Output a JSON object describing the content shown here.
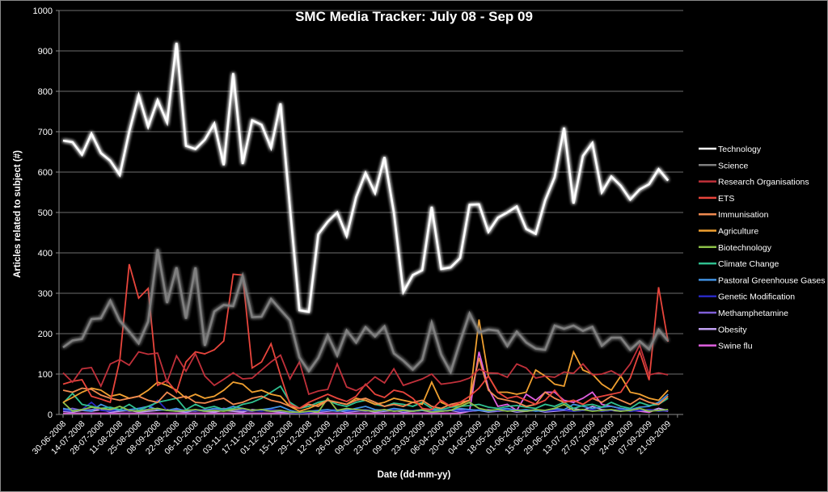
{
  "chart_data": {
    "type": "line",
    "title": "SMC Media Tracker: July 08 - Sep 09",
    "xlabel": "Date (dd-mm-yy)",
    "ylabel": "Articles related to subject (#)",
    "ylim": [
      0,
      1000
    ],
    "yticks": [
      0,
      100,
      200,
      300,
      400,
      500,
      600,
      700,
      800,
      900,
      1000
    ],
    "grid": true,
    "legend": "right",
    "x_tick_labels": [
      "30-06-2008",
      "14-07-2008",
      "28-07-2008",
      "11-08-2008",
      "25-08-2008",
      "08-09-2008",
      "22-09-2008",
      "06-10-2008",
      "20-10-2008",
      "03-11-2008",
      "17-11-2008",
      "01-12-2008",
      "15-12-2008",
      "29-12-2008",
      "12-01-2009",
      "26-01-2009",
      "09-02-2009",
      "23-02-2009",
      "09-03-2009",
      "23-03-2009",
      "06-04-2009",
      "20-04-2009",
      "04-05-2009",
      "18-05-2009",
      "01-06-2009",
      "15-06-2009",
      "29-06-2009",
      "13-07-2009",
      "27-07-2009",
      "10-08-2009",
      "24-08-2009",
      "07-09-2009",
      "21-09-2009"
    ],
    "series": [
      {
        "name": "Technology",
        "color": "#ffffff",
        "glow": true,
        "values": [
          678,
          674,
          643,
          695,
          647,
          628,
          593,
          700,
          790,
          712,
          778,
          723,
          920,
          665,
          657,
          680,
          720,
          617,
          845,
          620,
          728,
          717,
          660,
          770,
          512,
          258,
          254,
          446,
          477,
          500,
          442,
          538,
          598,
          548,
          637,
          500,
          303,
          345,
          357,
          514,
          360,
          364,
          387,
          519,
          520,
          452,
          487,
          500,
          515,
          459,
          447,
          530,
          587,
          710,
          522,
          640,
          672,
          550,
          589,
          566,
          532,
          557,
          570,
          607,
          579,
          null
        ]
      },
      {
        "name": "Science",
        "color": "#7f7f7f",
        "glow": true,
        "values": [
          166,
          183,
          187,
          236,
          238,
          282,
          232,
          205,
          176,
          230,
          409,
          276,
          364,
          237,
          364,
          170,
          255,
          271,
          268,
          343,
          241,
          242,
          286,
          259,
          233,
          141,
          107,
          140,
          196,
          146,
          208,
          178,
          216,
          193,
          218,
          151,
          133,
          111,
          135,
          227,
          148,
          105,
          180,
          250,
          203,
          210,
          207,
          169,
          205,
          178,
          163,
          160,
          220,
          212,
          220,
          207,
          217,
          170,
          190,
          190,
          160,
          181,
          161,
          210,
          182,
          null
        ]
      },
      {
        "name": "Research Organisations",
        "color": "#c0303a",
        "values": [
          103,
          80,
          113,
          116,
          70,
          125,
          136,
          122,
          155,
          149,
          152,
          80,
          145,
          107,
          150,
          95,
          72,
          87,
          103,
          88,
          90,
          110,
          130,
          147,
          88,
          130,
          50,
          58,
          62,
          125,
          68,
          59,
          72,
          93,
          78,
          113,
          72,
          80,
          88,
          100,
          75,
          78,
          82,
          90,
          112,
          103,
          102,
          92,
          125,
          115,
          90,
          95,
          92,
          105,
          102,
          125,
          98,
          100,
          108,
          95,
          125,
          172,
          98,
          103,
          98,
          null
        ]
      },
      {
        "name": "ETS",
        "color": "#e8453c",
        "values": [
          75,
          82,
          86,
          45,
          38,
          30,
          134,
          372,
          288,
          312,
          72,
          84,
          55,
          130,
          155,
          150,
          160,
          182,
          347,
          345,
          115,
          130,
          175,
          97,
          25,
          15,
          30,
          40,
          50,
          40,
          32,
          45,
          75,
          50,
          42,
          60,
          55,
          40,
          15,
          12,
          35,
          20,
          30,
          45,
          65,
          95,
          55,
          40,
          45,
          35,
          25,
          35,
          60,
          30,
          35,
          25,
          40,
          45,
          50,
          55,
          90,
          155,
          85,
          315,
          180,
          null
        ]
      },
      {
        "name": "Immunisation",
        "color": "#f08a50",
        "values": [
          60,
          55,
          65,
          62,
          48,
          40,
          35,
          40,
          45,
          35,
          30,
          55,
          40,
          45,
          30,
          28,
          35,
          40,
          25,
          30,
          40,
          45,
          35,
          30,
          20,
          15,
          25,
          20,
          35,
          30,
          25,
          35,
          40,
          30,
          20,
          25,
          20,
          30,
          35,
          20,
          15,
          25,
          30,
          35,
          140,
          60,
          40,
          35,
          30,
          20,
          25,
          55,
          40,
          30,
          35,
          25,
          40,
          30,
          45,
          35,
          25,
          40,
          30,
          25,
          45,
          null
        ]
      },
      {
        "name": "Agriculture",
        "color": "#f0a030",
        "values": [
          30,
          42,
          55,
          65,
          60,
          45,
          50,
          40,
          45,
          60,
          80,
          72,
          60,
          40,
          50,
          40,
          45,
          60,
          80,
          75,
          55,
          60,
          50,
          45,
          20,
          8,
          15,
          25,
          35,
          30,
          25,
          40,
          35,
          25,
          30,
          40,
          35,
          30,
          25,
          80,
          30,
          20,
          25,
          35,
          235,
          95,
          55,
          55,
          50,
          55,
          110,
          95,
          75,
          70,
          155,
          110,
          100,
          75,
          60,
          95,
          55,
          50,
          40,
          35,
          60,
          null
        ]
      },
      {
        "name": "Biotechnology",
        "color": "#8cc048",
        "values": [
          30,
          8,
          12,
          18,
          15,
          12,
          20,
          10,
          8,
          12,
          15,
          10,
          8,
          10,
          12,
          8,
          10,
          8,
          12,
          15,
          10,
          12,
          8,
          10,
          6,
          5,
          8,
          6,
          40,
          10,
          15,
          12,
          10,
          8,
          12,
          8,
          10,
          8,
          12,
          6,
          8,
          10,
          20,
          30,
          15,
          10,
          12,
          8,
          10,
          8,
          12,
          10,
          15,
          25,
          10,
          12,
          8,
          10,
          12,
          8,
          10,
          15,
          8,
          10,
          12,
          null
        ]
      },
      {
        "name": "Climate Change",
        "color": "#30c090",
        "values": [
          28,
          52,
          25,
          20,
          15,
          18,
          12,
          25,
          10,
          20,
          30,
          35,
          40,
          12,
          25,
          15,
          20,
          12,
          15,
          25,
          30,
          40,
          55,
          70,
          30,
          15,
          20,
          30,
          35,
          25,
          20,
          30,
          35,
          25,
          20,
          28,
          25,
          20,
          30,
          15,
          12,
          18,
          20,
          22,
          25,
          18,
          15,
          20,
          22,
          18,
          15,
          25,
          20,
          30,
          15,
          22,
          25,
          18,
          30,
          20,
          15,
          30,
          22,
          25,
          40,
          null
        ]
      },
      {
        "name": "Pastoral Greenhouse Gases",
        "color": "#4090e0",
        "values": [
          15,
          10,
          12,
          8,
          25,
          15,
          10,
          12,
          15,
          20,
          12,
          10,
          15,
          8,
          12,
          10,
          15,
          12,
          20,
          15,
          10,
          12,
          15,
          20,
          10,
          5,
          8,
          10,
          12,
          8,
          10,
          15,
          20,
          12,
          10,
          15,
          12,
          8,
          10,
          12,
          8,
          10,
          15,
          12,
          10,
          8,
          12,
          15,
          10,
          12,
          8,
          10,
          15,
          12,
          25,
          20,
          15,
          18,
          20,
          15,
          12,
          18,
          20,
          30,
          50,
          null
        ]
      },
      {
        "name": "Genetic Modification",
        "color": "#2828c0",
        "values": [
          10,
          8,
          12,
          30,
          10,
          8,
          12,
          10,
          15,
          12,
          35,
          10,
          8,
          12,
          10,
          8,
          12,
          10,
          15,
          12,
          10,
          8,
          12,
          10,
          5,
          3,
          5,
          8,
          10,
          12,
          8,
          10,
          12,
          8,
          10,
          12,
          8,
          10,
          12,
          8,
          10,
          12,
          8,
          10,
          12,
          8,
          10,
          12,
          8,
          10,
          12,
          8,
          10,
          12,
          8,
          10,
          12,
          8,
          10,
          12,
          8,
          10,
          12,
          8,
          10,
          null
        ]
      },
      {
        "name": "Methamphetamine",
        "color": "#8060d8",
        "values": [
          12,
          15,
          10,
          12,
          15,
          10,
          12,
          8,
          10,
          12,
          15,
          10,
          12,
          10,
          8,
          12,
          10,
          15,
          12,
          10,
          8,
          12,
          10,
          8,
          5,
          4,
          6,
          8,
          10,
          8,
          12,
          10,
          8,
          10,
          12,
          8,
          10,
          8,
          12,
          10,
          8,
          10,
          12,
          8,
          10,
          12,
          8,
          10,
          12,
          8,
          10,
          8,
          12,
          10,
          8,
          10,
          12,
          8,
          10,
          12,
          8,
          10,
          12,
          10,
          8,
          null
        ]
      },
      {
        "name": "Obesity",
        "color": "#c0a0f0",
        "values": [
          8,
          6,
          10,
          8,
          12,
          6,
          8,
          10,
          6,
          8,
          10,
          12,
          8,
          6,
          10,
          8,
          6,
          10,
          8,
          6,
          12,
          10,
          8,
          6,
          4,
          3,
          5,
          6,
          8,
          10,
          6,
          8,
          10,
          6,
          8,
          10,
          6,
          8,
          10,
          6,
          8,
          10,
          6,
          8,
          10,
          6,
          8,
          10,
          6,
          8,
          10,
          6,
          8,
          10,
          15,
          10,
          20,
          12,
          10,
          8,
          12,
          10,
          8,
          15,
          10,
          null
        ]
      },
      {
        "name": "Swine flu",
        "color": "#e060e0",
        "values": [
          3,
          3,
          3,
          3,
          3,
          3,
          3,
          3,
          3,
          3,
          3,
          3,
          3,
          3,
          3,
          3,
          3,
          3,
          3,
          3,
          3,
          3,
          3,
          3,
          3,
          3,
          3,
          3,
          3,
          3,
          3,
          3,
          3,
          3,
          3,
          3,
          3,
          3,
          3,
          3,
          3,
          3,
          3,
          8,
          155,
          65,
          20,
          25,
          10,
          50,
          35,
          55,
          55,
          35,
          30,
          40,
          55,
          25,
          20,
          15,
          10,
          8,
          5,
          15,
          8,
          null
        ]
      }
    ]
  }
}
